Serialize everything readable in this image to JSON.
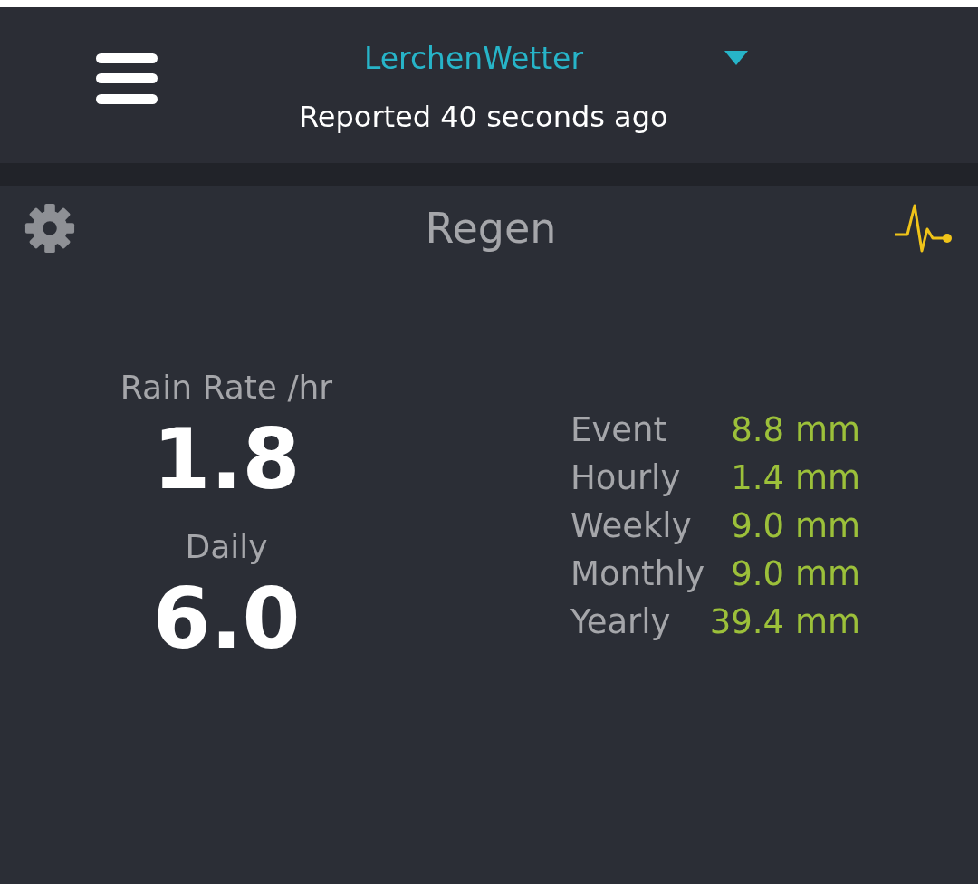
{
  "header": {
    "station": "LerchenWetter",
    "reported": "Reported 40 seconds ago"
  },
  "panel": {
    "title": "Regen",
    "primary": [
      {
        "label": "Rain Rate /hr",
        "value": "1.8"
      },
      {
        "label": "Daily",
        "value": "6.0"
      }
    ],
    "totals": [
      {
        "label": "Event",
        "value": "8.8 mm"
      },
      {
        "label": "Hourly",
        "value": "1.4 mm"
      },
      {
        "label": "Weekly",
        "value": "9.0 mm"
      },
      {
        "label": "Monthly",
        "value": "9.0 mm"
      },
      {
        "label": "Yearly",
        "value": "39.4 mm"
      }
    ]
  }
}
